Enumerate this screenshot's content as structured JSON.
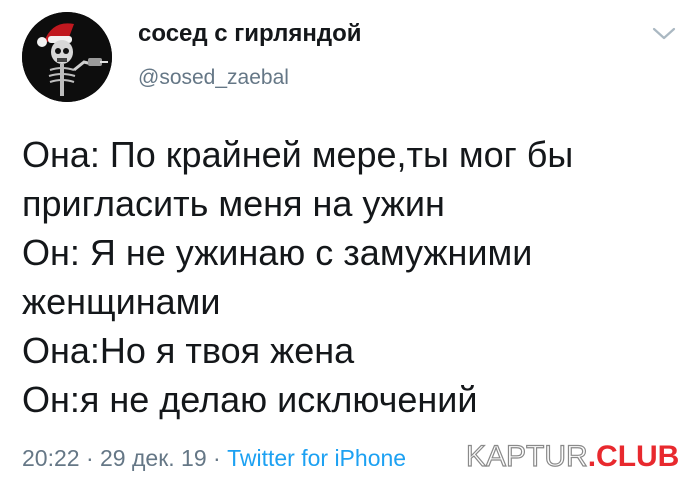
{
  "tweet": {
    "author": {
      "display_name": "сосед с гирляндой",
      "handle": "@sosed_zaebal"
    },
    "menu_icon": "chevron-down-icon",
    "text_lines": [
      "Она: По крайней мере,ты мог бы",
      "пригласить меня на ужин",
      "Он: Я не ужинаю с замужними",
      "женщинами",
      "Она:Но я твоя жена",
      "Он:я не делаю исключений"
    ],
    "time": "20:22",
    "separator": "·",
    "date": "29 дек. 19",
    "source": "Twitter for iPhone"
  },
  "watermark": {
    "part1": "KAPTUR",
    "part2": ".CLUB",
    "color_accent": "#e8292e"
  },
  "colors": {
    "text": "#14171a",
    "muted": "#657786",
    "link": "#1da1f2"
  }
}
